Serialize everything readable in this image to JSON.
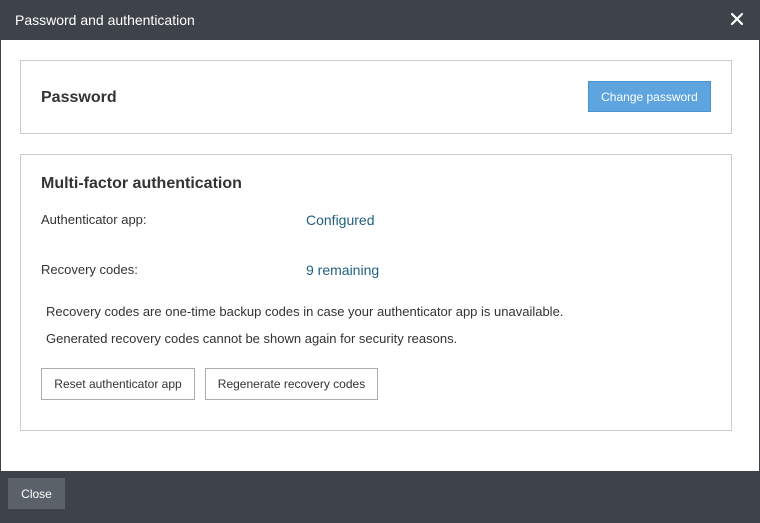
{
  "dialog": {
    "title": "Password and authentication",
    "close_icon": "close-icon"
  },
  "password_panel": {
    "heading": "Password",
    "change_button_label": "Change password"
  },
  "mfa_panel": {
    "heading": "Multi-factor authentication",
    "rows": [
      {
        "label": "Authenticator app:",
        "value": "Configured"
      },
      {
        "label": "Recovery codes:",
        "value": "9 remaining"
      }
    ],
    "notes": [
      "Recovery codes are one-time backup codes in case your authenticator app is unavailable.",
      "Generated recovery codes cannot be shown again for security reasons."
    ],
    "reset_button_label": "Reset authenticator app",
    "regenerate_button_label": "Regenerate recovery codes"
  },
  "footer": {
    "close_button_label": "Close"
  },
  "colors": {
    "header_bg": "#3d4349",
    "primary_button": "#5ea4df",
    "value_text": "#1f5f7f",
    "close_button_bg": "#5a6168"
  }
}
